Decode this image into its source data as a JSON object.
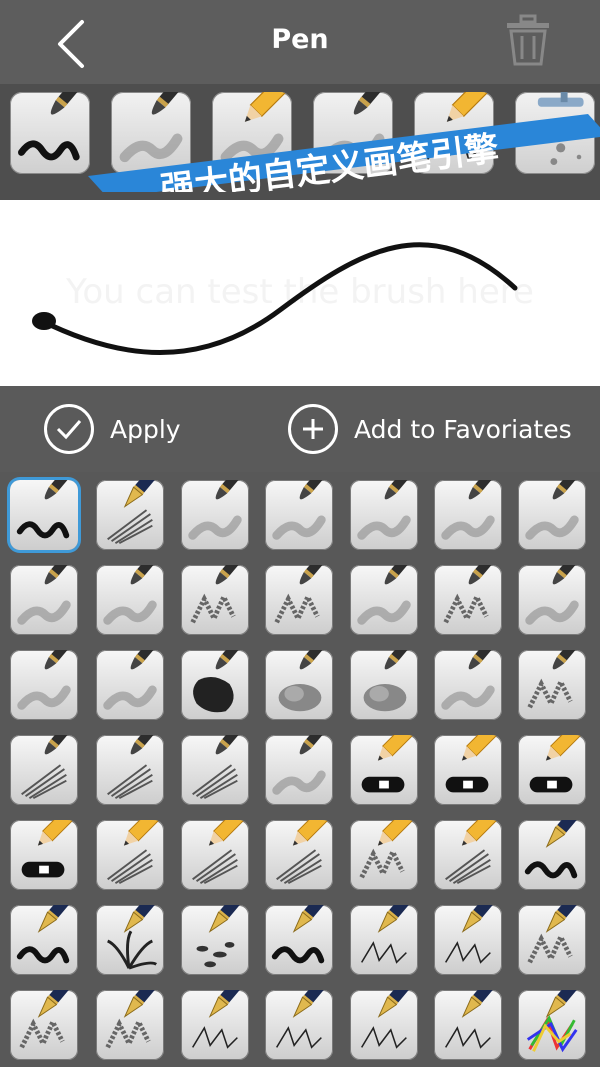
{
  "header": {
    "title": "Pen"
  },
  "banner": {
    "text": "强大的自定义画笔引擎",
    "color": "#2a86d8"
  },
  "favorites": [
    {
      "icon": "brush-icon",
      "stroke": "ink"
    },
    {
      "icon": "brush-icon",
      "stroke": "soft"
    },
    {
      "icon": "pencil-icon",
      "stroke": "soft"
    },
    {
      "icon": "brush-icon",
      "stroke": "soft"
    },
    {
      "icon": "pencil-icon",
      "stroke": "line"
    },
    {
      "icon": "airbrush-icon",
      "stroke": "spray"
    }
  ],
  "preview": {
    "hint": "You can test the brush here"
  },
  "actions": {
    "apply_label": "Apply",
    "favorite_label": "Add to Favoriates"
  },
  "brushes": [
    {
      "tool": "brush",
      "stroke": "ink",
      "selected": true
    },
    {
      "tool": "pen",
      "stroke": "hatch"
    },
    {
      "tool": "brush",
      "stroke": "soft"
    },
    {
      "tool": "brush",
      "stroke": "soft"
    },
    {
      "tool": "brush",
      "stroke": "soft"
    },
    {
      "tool": "brush",
      "stroke": "soft"
    },
    {
      "tool": "brush",
      "stroke": "soft"
    },
    {
      "tool": "brush",
      "stroke": "soft"
    },
    {
      "tool": "brush",
      "stroke": "soft"
    },
    {
      "tool": "brush",
      "stroke": "dry"
    },
    {
      "tool": "brush",
      "stroke": "dry"
    },
    {
      "tool": "brush",
      "stroke": "soft"
    },
    {
      "tool": "brush",
      "stroke": "dry"
    },
    {
      "tool": "brush",
      "stroke": "soft"
    },
    {
      "tool": "brush",
      "stroke": "soft"
    },
    {
      "tool": "brush",
      "stroke": "soft"
    },
    {
      "tool": "brush",
      "stroke": "blot"
    },
    {
      "tool": "brush",
      "stroke": "cloud"
    },
    {
      "tool": "brush",
      "stroke": "cloud"
    },
    {
      "tool": "brush",
      "stroke": "soft"
    },
    {
      "tool": "brush",
      "stroke": "dry"
    },
    {
      "tool": "brush",
      "stroke": "hatch"
    },
    {
      "tool": "brush",
      "stroke": "hatch"
    },
    {
      "tool": "brush",
      "stroke": "hatch"
    },
    {
      "tool": "brush",
      "stroke": "soft"
    },
    {
      "tool": "pencil",
      "stroke": "eraser"
    },
    {
      "tool": "pencil",
      "stroke": "eraser"
    },
    {
      "tool": "pencil",
      "stroke": "eraser"
    },
    {
      "tool": "pencil",
      "stroke": "eraser"
    },
    {
      "tool": "pencil",
      "stroke": "hatch"
    },
    {
      "tool": "pencil",
      "stroke": "hatch"
    },
    {
      "tool": "pencil",
      "stroke": "hatch"
    },
    {
      "tool": "pencil",
      "stroke": "dry"
    },
    {
      "tool": "pencil",
      "stroke": "hatch"
    },
    {
      "tool": "pen",
      "stroke": "ink"
    },
    {
      "tool": "pen",
      "stroke": "ink"
    },
    {
      "tool": "pen",
      "stroke": "grass"
    },
    {
      "tool": "pen",
      "stroke": "leaf"
    },
    {
      "tool": "pen",
      "stroke": "ink"
    },
    {
      "tool": "pen",
      "stroke": "line"
    },
    {
      "tool": "pen",
      "stroke": "line"
    },
    {
      "tool": "pen",
      "stroke": "dry"
    },
    {
      "tool": "pen",
      "stroke": "dry"
    },
    {
      "tool": "pen",
      "stroke": "dry"
    },
    {
      "tool": "pen",
      "stroke": "line"
    },
    {
      "tool": "pen",
      "stroke": "line"
    },
    {
      "tool": "pen",
      "stroke": "line"
    },
    {
      "tool": "pen",
      "stroke": "line"
    },
    {
      "tool": "pen",
      "stroke": "rainbow"
    }
  ]
}
